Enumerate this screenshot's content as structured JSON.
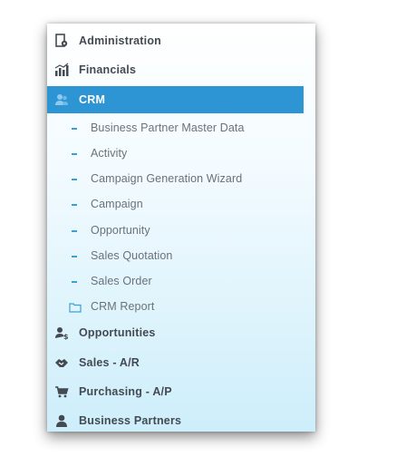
{
  "menu": {
    "items": [
      {
        "label": "Administration",
        "icon": "gear-document-icon"
      },
      {
        "label": "Financials",
        "icon": "bar-chart-icon"
      },
      {
        "label": "CRM",
        "icon": "user-group-icon",
        "active": true
      },
      {
        "label": "Opportunities",
        "icon": "user-dollar-icon"
      },
      {
        "label": "Sales - A/R",
        "icon": "handshake-icon"
      },
      {
        "label": "Purchasing - A/P",
        "icon": "cart-icon"
      },
      {
        "label": "Business Partners",
        "icon": "person-icon"
      }
    ],
    "crm_subitems": [
      {
        "label": "Business Partner Master Data",
        "icon": "dash-icon"
      },
      {
        "label": "Activity",
        "icon": "dash-icon"
      },
      {
        "label": "Campaign Generation Wizard",
        "icon": "dash-icon"
      },
      {
        "label": "Campaign",
        "icon": "dash-icon"
      },
      {
        "label": "Opportunity",
        "icon": "dash-icon"
      },
      {
        "label": "Sales Quotation",
        "icon": "dash-icon"
      },
      {
        "label": "Sales Order",
        "icon": "dash-icon"
      },
      {
        "label": "CRM Report",
        "icon": "folder-icon"
      }
    ]
  },
  "colors": {
    "active_bg": "#2d95d3",
    "accent": "#3aa0d8",
    "text": "#444a52"
  }
}
